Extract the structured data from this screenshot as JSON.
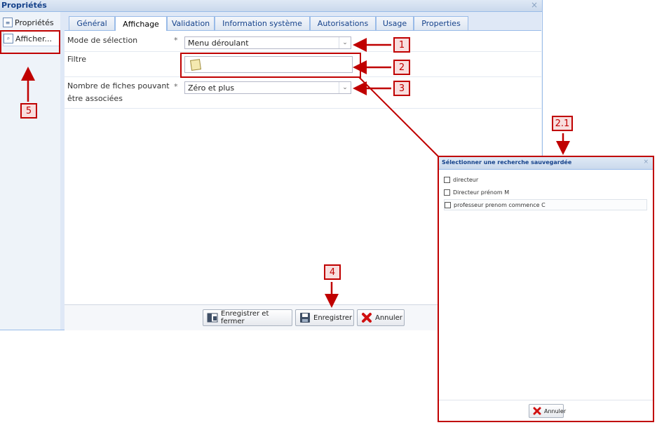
{
  "window": {
    "title": "Propriétés",
    "close_glyph": "×"
  },
  "leftnav": {
    "items": [
      {
        "label": "Propriétés",
        "icon": "document-icon"
      },
      {
        "label": "Afficher...",
        "icon": "magnifier-icon"
      }
    ]
  },
  "tabs": [
    "Général",
    "Affichage",
    "Validation",
    "Information système",
    "Autorisations",
    "Usage",
    "Properties"
  ],
  "active_tab": "Affichage",
  "form": {
    "mode_label": "Mode de sélection",
    "mode_value": "Menu déroulant",
    "filter_label": "Filtre",
    "count_label_1": "Nombre de fiches pouvant",
    "count_label_2": "être associées",
    "count_value": "Zéro et plus",
    "required_mark": "*"
  },
  "footer": {
    "save_close": "Enregistrer et fermer",
    "save": "Enregistrer",
    "cancel": "Annuler"
  },
  "dialog": {
    "title": "Sélectionner une recherche sauvegardée",
    "close_glyph": "×",
    "items": [
      "directeur",
      "Directeur prénom M",
      "professeur prenom commence C"
    ],
    "cancel": "Annuler"
  },
  "callouts": [
    "1",
    "2",
    "3",
    "4",
    "5",
    "2.1"
  ],
  "colors": {
    "annotation": "#c00000",
    "accent": "#15428b"
  }
}
